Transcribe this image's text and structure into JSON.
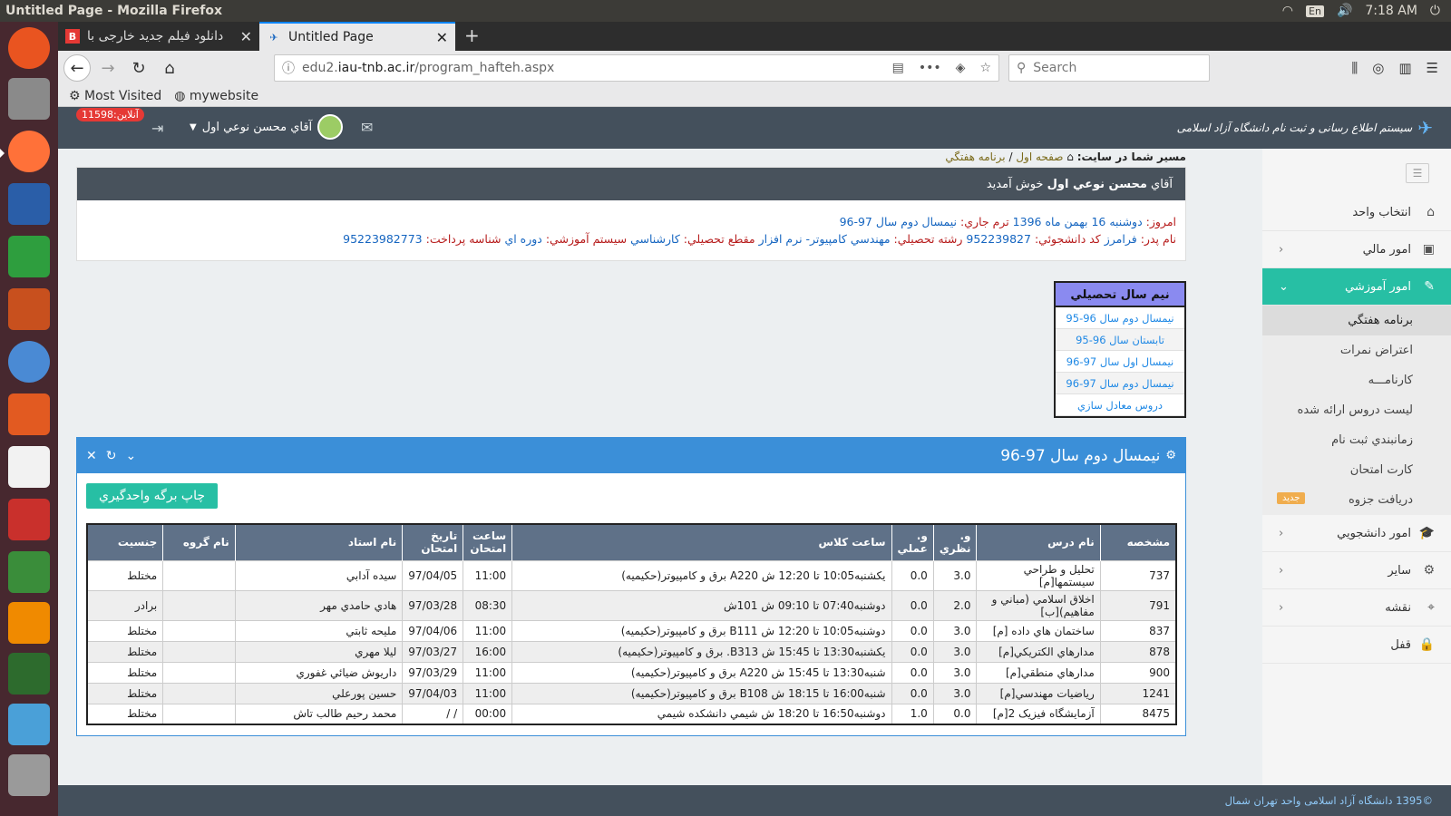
{
  "os": {
    "window_title": "Untitled Page - Mozilla Firefox",
    "lang": "En",
    "time": "7:18 AM"
  },
  "browser": {
    "tabs": [
      {
        "title": "دانلود فیلم جدید خارجی با",
        "favicon": "B"
      },
      {
        "title": "Untitled Page",
        "favicon": "iau"
      }
    ],
    "url_prefix": "edu2.",
    "url_domain": "iau-tnb.ac.ir",
    "url_path": "/program_hafteh.aspx",
    "search_placeholder": "Search",
    "bookmarks": [
      "Most Visited",
      "mywebsite"
    ]
  },
  "header": {
    "site_title": "سیستم اطلاع رسانی و ثبت نام دانشگاه آزاد اسلامی",
    "user_name": "آقاي محسن نوعي اول",
    "online_badge": "آنلاین:11598"
  },
  "breadcrumb": {
    "label": "مسیر شما در سایت:",
    "home": "صفحه اول",
    "sep": "/",
    "current": "برنامه هفتگي"
  },
  "welcome": {
    "title_prefix": "آقاي",
    "title_name": "محسن نوعي اول",
    "title_suffix": "خوش آمديد",
    "today_label": "امروز:",
    "today_value": "دوشنبه 16 بهمن ماه 1396",
    "term_label": "ترم جاري:",
    "term_value": "نيمسال دوم سال 97-96",
    "father_label": "نام پدر:",
    "father_value": "فرامرز",
    "sid_label": "کد دانشجوئي:",
    "sid_value": "952239827",
    "field_label": "رشته تحصيلي:",
    "field_value": "مهندسي کامپيوتر- نرم افزار",
    "level_label": "مقطع تحصيلي:",
    "level_value": "کارشناسي",
    "system_label": "سيستم آموزشي:",
    "system_value": "دوره اي",
    "pay_label": "شناسه پرداخت:",
    "pay_value": "95223982773"
  },
  "semesters": {
    "title": "نيم سال تحصيلي",
    "items": [
      "نيمسال دوم سال 96-95",
      "تابستان سال 96-95",
      "نيمسال اول سال 97-96",
      "نيمسال دوم سال 97-96",
      "دروس معادل سازي"
    ]
  },
  "panel": {
    "title": "نيمسال دوم سال 97-96",
    "print_button": "چاپ برگه واحدگيري"
  },
  "table": {
    "headers": [
      "مشخصه",
      "نام درس",
      "و. نظري",
      "و. عملي",
      "ساعت کلاس",
      "ساعت امتحان",
      "تاريخ امتحان",
      "نام استاد",
      "نام گروه",
      "جنسيت"
    ],
    "rows": [
      [
        "737",
        "تحليل و طراحي سيستمها[م]",
        "3.0",
        "0.0",
        "يکشنبه10:05 تا 12:20 ش A220 برق و کامپيوتر(حکيميه)",
        "11:00",
        "97/04/05",
        "سيده آدابي",
        "",
        "مختلط"
      ],
      [
        "791",
        "اخلاق اسلامي (مباني و مفاهيم)[ب]",
        "2.0",
        "0.0",
        "دوشنبه07:40 تا 09:10 ش 101ش",
        "08:30",
        "97/03/28",
        "هادي حامدي مهر",
        "",
        "برادر"
      ],
      [
        "837",
        "ساختمان هاي داده [م]",
        "3.0",
        "0.0",
        "دوشنبه10:05 تا 12:20 ش B111 برق و کامپيوتر(حکيميه)",
        "11:00",
        "97/04/06",
        "مليحه ثابتي",
        "",
        "مختلط"
      ],
      [
        "878",
        "مدارهاي الکتريکي[م]",
        "3.0",
        "0.0",
        "يکشنبه13:30 تا 15:45 ش B313. برق و کامپيوتر(حکيميه)",
        "16:00",
        "97/03/27",
        "ليلا مهري",
        "",
        "مختلط"
      ],
      [
        "900",
        "مدارهاي منطقي[م]",
        "3.0",
        "0.0",
        "شنبه13:30 تا 15:45 ش A220 برق و کامپيوتر(حکيميه)",
        "11:00",
        "97/03/29",
        "داريوش ضيائي غفوري",
        "",
        "مختلط"
      ],
      [
        "1241",
        "رياضيات مهندسي[م]",
        "3.0",
        "0.0",
        "شنبه16:00 تا 18:15 ش B108 برق و کامپيوتر(حکيميه)",
        "11:00",
        "97/04/03",
        "حسين پورعلي",
        "",
        "مختلط"
      ],
      [
        "8475",
        "آزمايشگاه فيزيک 2[م]",
        "0.0",
        "1.0",
        "دوشنبه16:50 تا 18:20 ش شيمي دانشکده شيمي",
        "00:00",
        "/ /",
        "محمد رحيم طالب تاش",
        "",
        "مختلط"
      ]
    ]
  },
  "sidebar": {
    "items": [
      {
        "label": "انتخاب واحد",
        "icon": "home-icon"
      },
      {
        "label": "امور مالي",
        "icon": "money-icon"
      },
      {
        "label": "امور آموزشي",
        "icon": "pencil-icon"
      }
    ],
    "sub_items": [
      "برنامه هفتگي",
      "اعتراض نمرات",
      "کارنامـــه",
      "ليست دروس ارائه شده",
      "زمانبندي ثبت نام",
      "کارت امتحان",
      "دریافت جزوه"
    ],
    "new_badge": "جديد",
    "items_after": [
      {
        "label": "امور دانشجويي",
        "icon": "graduation-icon"
      },
      {
        "label": "ساير",
        "icon": "gear-icon"
      },
      {
        "label": "نقشه",
        "icon": "map-pin-icon"
      },
      {
        "label": "قفل",
        "icon": "lock-icon"
      }
    ]
  },
  "footer": {
    "text": "©1395 دانشگاه آزاد اسلامی واحد تهران شمال"
  }
}
